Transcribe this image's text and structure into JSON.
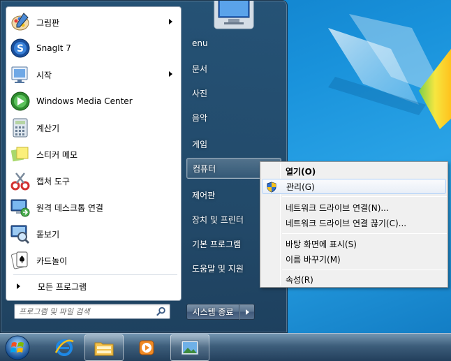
{
  "start_menu": {
    "programs": [
      {
        "label": "그림판",
        "icon": "paint-icon",
        "has_submenu": true
      },
      {
        "label": "SnagIt 7",
        "icon": "snagit-icon",
        "has_submenu": false
      },
      {
        "label": "시작",
        "icon": "getting-started-icon",
        "has_submenu": true
      },
      {
        "label": "Windows Media Center",
        "icon": "media-center-icon",
        "has_submenu": false
      },
      {
        "label": "계산기",
        "icon": "calculator-icon",
        "has_submenu": false
      },
      {
        "label": "스티커 메모",
        "icon": "sticky-notes-icon",
        "has_submenu": false
      },
      {
        "label": "캡처 도구",
        "icon": "snipping-tool-icon",
        "has_submenu": false
      },
      {
        "label": "원격 데스크톱 연결",
        "icon": "remote-desktop-icon",
        "has_submenu": false
      },
      {
        "label": "돋보기",
        "icon": "magnifier-icon",
        "has_submenu": false
      },
      {
        "label": "카드놀이",
        "icon": "solitaire-icon",
        "has_submenu": false
      }
    ],
    "all_programs_label": "모든 프로그램",
    "search": {
      "placeholder": "프로그램 및 파일 검색",
      "value": ""
    },
    "right_items": [
      {
        "label": "enu"
      },
      {
        "label": "문서"
      },
      {
        "label": "사진"
      },
      {
        "label": "음악"
      },
      {
        "label": "게임"
      },
      {
        "label": "컴퓨터",
        "selected": true
      },
      {
        "label": "제어판"
      },
      {
        "label": "장치 및 프린터"
      },
      {
        "label": "기본 프로그램"
      },
      {
        "label": "도움말 및 지원"
      }
    ],
    "shutdown_label": "시스템 종료"
  },
  "context_menu": {
    "items": [
      {
        "label": "열기(O)",
        "bold": true
      },
      {
        "label": "관리(G)",
        "icon": "shield-icon",
        "hover": true
      },
      {
        "label": "네트워크 드라이브 연결(N)..."
      },
      {
        "label": "네트워크 드라이브 연결 끊기(C)..."
      },
      {
        "label": "바탕 화면에 표시(S)"
      },
      {
        "label": "이름 바꾸기(M)"
      },
      {
        "label": "속성(R)"
      }
    ]
  },
  "taskbar": {
    "buttons": [
      {
        "icon": "start-orb-icon"
      },
      {
        "icon": "internet-explorer-icon"
      },
      {
        "icon": "windows-explorer-icon",
        "active": true
      },
      {
        "icon": "media-player-icon"
      },
      {
        "icon": "picture-viewer-icon",
        "active": true
      }
    ]
  },
  "colors": {
    "accent": "#1992db",
    "menu_frame": "#284b69",
    "context_hover": "#aecff7"
  }
}
